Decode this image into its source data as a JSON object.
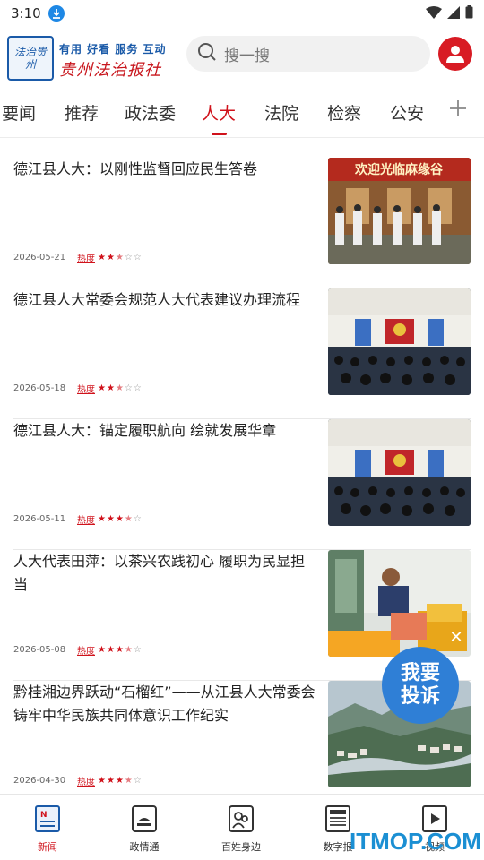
{
  "status_bar": {
    "time": "3:10"
  },
  "header": {
    "logo": {
      "seal_text": "法治贵州",
      "slogan": "有用 好看 服务 互动",
      "name": "贵州法治报社"
    },
    "search": {
      "placeholder": "搜一搜"
    }
  },
  "tabs": [
    {
      "label": "要闻"
    },
    {
      "label": "推荐"
    },
    {
      "label": "政法委"
    },
    {
      "label": "人大",
      "active": true
    },
    {
      "label": "法院"
    },
    {
      "label": "检察"
    },
    {
      "label": "公安"
    }
  ],
  "news": [
    {
      "title": "德江县人大：以刚性监督回应民生答卷",
      "date": "2026-05-21",
      "heat_label": "热度",
      "heat": 2.5,
      "thumb_banner": "欢迎光临麻缘谷"
    },
    {
      "title": "德江县人大常委会规范人大代表建议办理流程",
      "date": "2026-05-18",
      "heat_label": "热度",
      "heat": 2.5
    },
    {
      "title": "德江县人大：锚定履职航向 绘就发展华章",
      "date": "2026-05-11",
      "heat_label": "热度",
      "heat": 3.5
    },
    {
      "title": "人大代表田萍：以茶兴农践初心 履职为民显担当",
      "date": "2026-05-08",
      "heat_label": "热度",
      "heat": 3.5
    },
    {
      "title": "黔桂湘边界跃动“石榴红”——从江县人大常委会铸牢中华民族共同体意识工作纪实",
      "date": "2026-04-30",
      "heat_label": "热度",
      "heat": 3.5
    }
  ],
  "float_button": {
    "label_line1": "我要",
    "label_line2": "投诉"
  },
  "bottom_nav": [
    {
      "label": "新闻",
      "icon": "news-icon",
      "active": true
    },
    {
      "label": "政情通",
      "icon": "government-icon"
    },
    {
      "label": "百姓身边",
      "icon": "people-icon"
    },
    {
      "label": "数字报",
      "icon": "newspaper-icon"
    },
    {
      "label": "视频",
      "icon": "video-icon"
    }
  ],
  "watermark": "ITMOP.COM",
  "colors": {
    "accent": "#d0121b",
    "brand_blue": "#1a5aa8",
    "float_blue": "#2f7fd6"
  }
}
